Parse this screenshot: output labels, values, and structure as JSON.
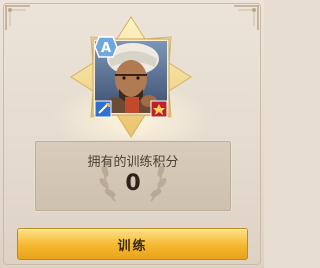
{
  "hero": {
    "class_icon": "letter-a-rank-icon",
    "class_letter": "A",
    "weapon_icon": "sword-icon",
    "troop_icon": "soldier-emblem-icon"
  },
  "points": {
    "label": "拥有的训练积分",
    "value": "0"
  },
  "actions": {
    "train_label": "训练"
  },
  "colors": {
    "button_gold": "#f5b830",
    "panel_bg": "#e6ddd0",
    "frame_gold": "#e8c97a"
  }
}
